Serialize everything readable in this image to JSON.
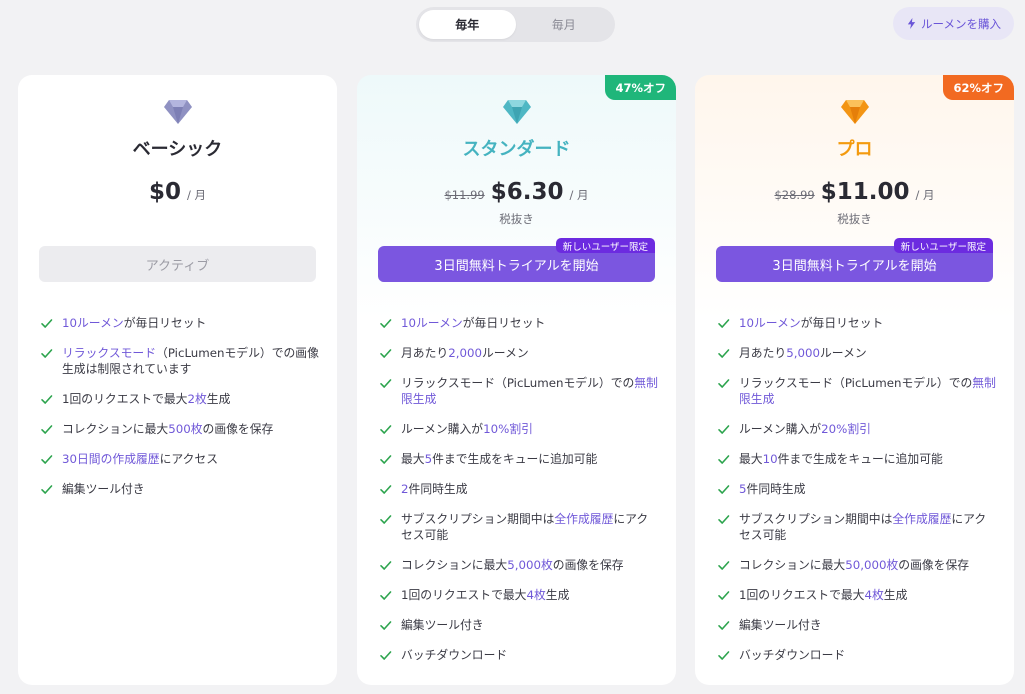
{
  "billing_toggle": {
    "yearly": "毎年",
    "monthly": "毎月"
  },
  "buy_lumens": {
    "label": "ルーメンを購入"
  },
  "colors": {
    "accent": "#7b56e0",
    "check": "#2da44e",
    "highlight": "#7058d8",
    "discount_green": "#1fb67a",
    "discount_orange": "#f26a21"
  },
  "plans": [
    {
      "name": "ベーシック",
      "price": "$0",
      "per": "/ 月",
      "cta": "アクティブ",
      "features": [
        [
          {
            "t": "10ルーメン",
            "h": true
          },
          {
            "t": "が毎日リセット"
          }
        ],
        [
          {
            "t": "リラックスモード",
            "h": true
          },
          {
            "t": "（PicLumenモデル）での画像生成は制限されています"
          }
        ],
        [
          {
            "t": "1回のリクエストで最大"
          },
          {
            "t": "2枚",
            "h": true
          },
          {
            "t": "生成"
          }
        ],
        [
          {
            "t": "コレクションに最大"
          },
          {
            "t": "500枚",
            "h": true
          },
          {
            "t": "の画像を保存"
          }
        ],
        [
          {
            "t": "30日間の作成履歴",
            "h": true
          },
          {
            "t": "にアクセス"
          }
        ],
        [
          {
            "t": "編集ツール付き"
          }
        ]
      ]
    },
    {
      "name": "スタンダード",
      "discount": "47%オフ",
      "original_price": "$11.99",
      "price": "$6.30",
      "per": "/ 月",
      "tax": "税抜き",
      "badge": "新しいユーザー限定",
      "cta": "3日間無料トライアルを開始",
      "features": [
        [
          {
            "t": "10ルーメン",
            "h": true
          },
          {
            "t": "が毎日リセット"
          }
        ],
        [
          {
            "t": "月あたり"
          },
          {
            "t": "2,000",
            "h": true
          },
          {
            "t": "ルーメン"
          }
        ],
        [
          {
            "t": "リラックスモード（PicLumenモデル）での"
          },
          {
            "t": "無制限生成",
            "h": true
          }
        ],
        [
          {
            "t": "ルーメン購入が"
          },
          {
            "t": "10%割引",
            "h": true
          }
        ],
        [
          {
            "t": "最大"
          },
          {
            "t": "5",
            "h": true
          },
          {
            "t": "件まで生成をキューに追加可能"
          }
        ],
        [
          {
            "t": "2",
            "h": true
          },
          {
            "t": "件同時生成"
          }
        ],
        [
          {
            "t": "サブスクリプション期間中は"
          },
          {
            "t": "全作成履歴",
            "h": true
          },
          {
            "t": "にアクセス可能"
          }
        ],
        [
          {
            "t": "コレクションに最大"
          },
          {
            "t": "5,000枚",
            "h": true
          },
          {
            "t": "の画像を保存"
          }
        ],
        [
          {
            "t": "1回のリクエストで最大"
          },
          {
            "t": "4枚",
            "h": true
          },
          {
            "t": "生成"
          }
        ],
        [
          {
            "t": "編集ツール付き"
          }
        ],
        [
          {
            "t": "バッチダウンロード"
          }
        ]
      ]
    },
    {
      "name": "プロ",
      "discount": "62%オフ",
      "original_price": "$28.99",
      "price": "$11.00",
      "per": "/ 月",
      "tax": "税抜き",
      "badge": "新しいユーザー限定",
      "cta": "3日間無料トライアルを開始",
      "features": [
        [
          {
            "t": "10ルーメン",
            "h": true
          },
          {
            "t": "が毎日リセット"
          }
        ],
        [
          {
            "t": "月あたり"
          },
          {
            "t": "5,000",
            "h": true
          },
          {
            "t": "ルーメン"
          }
        ],
        [
          {
            "t": "リラックスモード（PicLumenモデル）での"
          },
          {
            "t": "無制限生成",
            "h": true
          }
        ],
        [
          {
            "t": "ルーメン購入が"
          },
          {
            "t": "20%割引",
            "h": true
          }
        ],
        [
          {
            "t": "最大"
          },
          {
            "t": "10",
            "h": true
          },
          {
            "t": "件まで生成をキューに追加可能"
          }
        ],
        [
          {
            "t": "5",
            "h": true
          },
          {
            "t": "件同時生成"
          }
        ],
        [
          {
            "t": "サブスクリプション期間中は"
          },
          {
            "t": "全作成履歴",
            "h": true
          },
          {
            "t": "にアクセス可能"
          }
        ],
        [
          {
            "t": "コレクションに最大"
          },
          {
            "t": "50,000枚",
            "h": true
          },
          {
            "t": "の画像を保存"
          }
        ],
        [
          {
            "t": "1回のリクエストで最大"
          },
          {
            "t": "4枚",
            "h": true
          },
          {
            "t": "生成"
          }
        ],
        [
          {
            "t": "編集ツール付き"
          }
        ],
        [
          {
            "t": "バッチダウンロード"
          }
        ]
      ]
    }
  ]
}
